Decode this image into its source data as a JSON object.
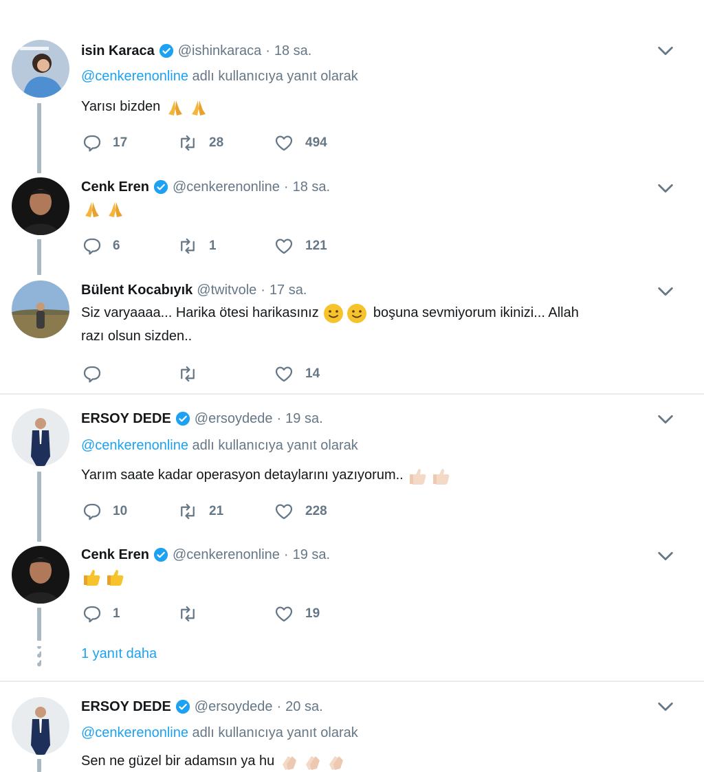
{
  "tweets": [
    {
      "name": "isin Karaca",
      "verified": true,
      "handle": "@ishinkaraca",
      "dot": "·",
      "time": "18 sa.",
      "reply_mention": "@cenkerenonline",
      "reply_suffix": " adlı kullanıcıya yanıt olarak",
      "text": "Yarısı bizden",
      "emojis": [
        "folded-hands-emoji",
        "folded-hands-emoji"
      ],
      "replies": "17",
      "retweets": "28",
      "likes": "494"
    },
    {
      "name": "Cenk Eren",
      "verified": true,
      "handle": "@cenkerenonline",
      "dot": "·",
      "time": "18 sa.",
      "text": "",
      "emojis": [
        "folded-hands-emoji",
        "folded-hands-emoji"
      ],
      "replies": "6",
      "retweets": "1",
      "likes": "121"
    },
    {
      "name": "Bülent Kocabıyık",
      "verified": false,
      "handle": "@twitvole",
      "dot": "·",
      "time": "17 sa.",
      "text_before": "Siz varyaaaa... Harika ötesi harikasınız",
      "emojis": [
        "slightly-smiling-emoji",
        "slightly-smiling-emoji"
      ],
      "text_after": "boşuna sevmiyorum ikinizi... Allah",
      "text_line2": "razı olsun sizden..",
      "replies": "",
      "retweets": "",
      "likes": "14"
    },
    {
      "name": "ERSOY DEDE",
      "verified": true,
      "handle": "@ersoydede",
      "dot": "·",
      "time": "19 sa.",
      "reply_mention": "@cenkerenonline",
      "reply_suffix": " adlı kullanıcıya yanıt olarak",
      "text": "Yarım saate kadar operasyon detaylarını yazıyorum..",
      "emojis": [
        "thumbs-up-emoji",
        "thumbs-up-emoji"
      ],
      "replies": "10",
      "retweets": "21",
      "likes": "228"
    },
    {
      "name": "Cenk Eren",
      "verified": true,
      "handle": "@cenkerenonline",
      "dot": "·",
      "time": "19 sa.",
      "text": "",
      "emojis": [
        "thumbs-up-emoji",
        "thumbs-up-emoji"
      ],
      "replies": "1",
      "retweets": "",
      "likes": "19"
    },
    {
      "name": "ERSOY DEDE",
      "verified": true,
      "handle": "@ersoydede",
      "dot": "·",
      "time": "20 sa.",
      "reply_mention": "@cenkerenonline",
      "reply_suffix": " adlı kullanıcıya yanıt olarak",
      "text": "Sen ne güzel bir adamsın ya hu",
      "emojis": [
        "clapping-hands-emoji",
        "clapping-hands-emoji",
        "clapping-hands-emoji"
      ]
    }
  ],
  "show_more": "1 yanıt daha",
  "colors": {
    "link": "#1da1f2",
    "muted": "#657786",
    "connector": "#aab8c2",
    "separator": "#e6ecf0"
  }
}
